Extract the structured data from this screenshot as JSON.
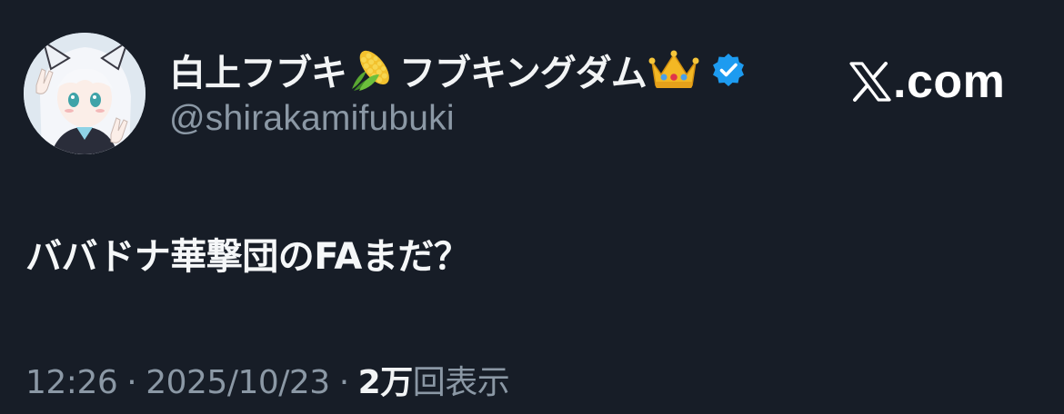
{
  "author": {
    "display_name": "白上フブキ",
    "display_name_suffix": "フブキングダム",
    "handle": "@shirakamifubuki",
    "verified": true,
    "name_emojis": [
      "corn-emoji",
      "crown-emoji"
    ],
    "verified_color": "#1d9bf0"
  },
  "brand": {
    "logo": "x-logo-icon",
    "text": ".com"
  },
  "tweet": {
    "text": "ババドナ華撃団のFAまだ？"
  },
  "meta": {
    "time": "12:26",
    "separator": "·",
    "date": "2025/10/23",
    "views_count": "2万",
    "views_label": "回表示"
  },
  "colors": {
    "background": "#171d27",
    "primary_text": "#f2f4f5",
    "secondary_text": "#8b98a5"
  }
}
